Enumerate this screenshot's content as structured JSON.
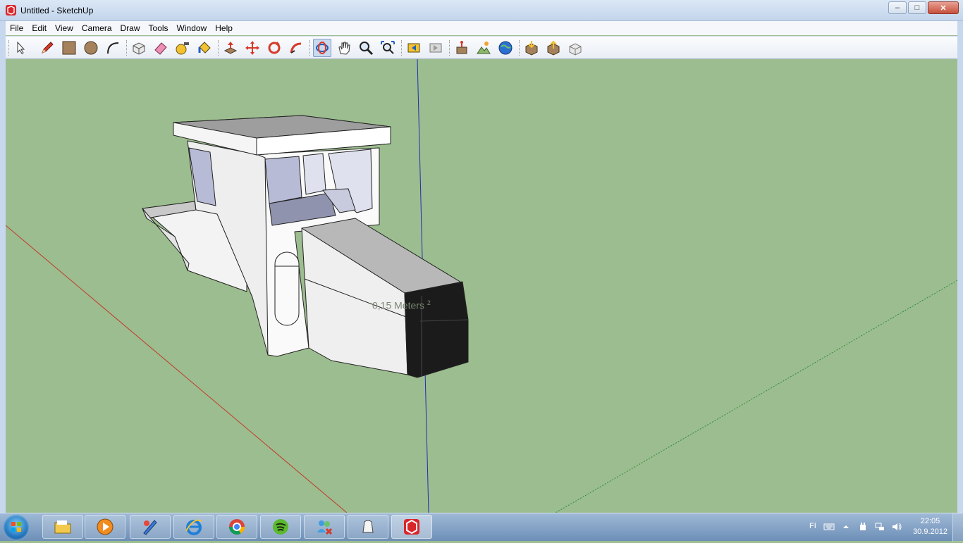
{
  "window": {
    "title": "Untitled - SketchUp",
    "minimize": "–",
    "maximize": "□",
    "close": "✕"
  },
  "menu": [
    "File",
    "Edit",
    "View",
    "Camera",
    "Draw",
    "Tools",
    "Window",
    "Help"
  ],
  "toolbar": {
    "tools": [
      {
        "name": "select-tool",
        "icon": "arrow-icon"
      },
      {
        "name": "pencil-tool",
        "icon": "pencil-icon"
      },
      {
        "name": "rectangle-tool",
        "icon": "rectangle-icon"
      },
      {
        "name": "circle-tool",
        "icon": "circle-icon"
      },
      {
        "name": "arc-tool",
        "icon": "arc-icon"
      },
      {
        "name": "make-component-tool",
        "icon": "component-icon"
      },
      {
        "name": "eraser-tool",
        "icon": "eraser-icon"
      },
      {
        "name": "tape-measure-tool",
        "icon": "tape-icon"
      },
      {
        "name": "paint-bucket-tool",
        "icon": "paint-bucket-icon"
      },
      {
        "name": "push-pull-tool",
        "icon": "push-pull-icon"
      },
      {
        "name": "move-tool",
        "icon": "move-icon"
      },
      {
        "name": "rotate-tool",
        "icon": "rotate-icon"
      },
      {
        "name": "follow-me-tool",
        "icon": "follow-me-icon"
      },
      {
        "name": "orbit-tool",
        "icon": "orbit-icon"
      },
      {
        "name": "pan-tool",
        "icon": "hand-icon"
      },
      {
        "name": "zoom-tool",
        "icon": "magnifier-icon"
      },
      {
        "name": "zoom-extents-tool",
        "icon": "zoom-extents-icon"
      },
      {
        "name": "previous-view-tool",
        "icon": "previous-view-icon"
      },
      {
        "name": "next-view-tool",
        "icon": "next-view-icon"
      },
      {
        "name": "add-location-tool",
        "icon": "location-icon"
      },
      {
        "name": "toggle-terrain-tool",
        "icon": "terrain-icon"
      },
      {
        "name": "google-earth-tool",
        "icon": "globe-icon"
      },
      {
        "name": "get-models-tool",
        "icon": "get-models-icon"
      },
      {
        "name": "share-model-tool",
        "icon": "share-model-icon"
      },
      {
        "name": "share-component-tool",
        "icon": "share-component-icon"
      }
    ],
    "active_tool": "orbit-tool"
  },
  "viewport": {
    "measure_value": "0,15 Meters",
    "measure_unit_sup": "2",
    "ground_color": "#9cbd8f",
    "axis_colors": {
      "red": "#c0392b",
      "green": "#2e8b3c",
      "blue": "#1f2fb3"
    }
  },
  "taskbar": {
    "apps": [
      {
        "name": "windows-explorer",
        "icon": "folder-icon"
      },
      {
        "name": "media-player",
        "icon": "media-play-icon"
      },
      {
        "name": "paint-app",
        "icon": "paint-icon"
      },
      {
        "name": "internet-explorer",
        "icon": "ie-icon"
      },
      {
        "name": "chrome",
        "icon": "chrome-icon"
      },
      {
        "name": "spotify",
        "icon": "spotify-icon"
      },
      {
        "name": "messenger",
        "icon": "messenger-icon"
      },
      {
        "name": "printer-app",
        "icon": "device-icon"
      },
      {
        "name": "sketchup",
        "icon": "sketchup-icon"
      }
    ],
    "language": "FI",
    "time": "22:05",
    "date": "30.9.2012"
  }
}
